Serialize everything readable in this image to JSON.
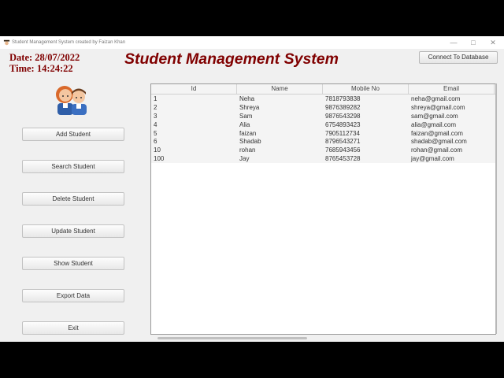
{
  "window": {
    "title": "Student Management System created by Faizan Khan",
    "minimize_glyph": "—",
    "maximize_glyph": "□",
    "close_glyph": "✕"
  },
  "header": {
    "date_label": "Date: 28/07/2022",
    "time_label": "Time: 14:24:22",
    "title": "Student Management System",
    "connect_button": "Connect To Database"
  },
  "sidebar": {
    "buttons": [
      "Add Student",
      "Search Student",
      "Delete Student",
      "Update Student",
      "Show Student",
      "Export Data",
      "Exit"
    ]
  },
  "table": {
    "columns": [
      "Id",
      "Name",
      "Mobile No",
      "Email"
    ],
    "rows": [
      [
        "1",
        "Neha",
        "7818793838",
        "neha@gmail.com"
      ],
      [
        "2",
        "Shreya",
        "9876389282",
        "shreya@gmail.com"
      ],
      [
        "3",
        "Sam",
        "9876543298",
        "sam@gmail.com"
      ],
      [
        "4",
        "Alia",
        "6754893423",
        "alia@gmail.com"
      ],
      [
        "5",
        "faizan",
        "7905112734",
        "faizan@gmail.com"
      ],
      [
        "6",
        "Shadab",
        "8796543271",
        "shadab@gmail.com"
      ],
      [
        "10",
        "rohan",
        "7685943456",
        "rohan@gmail.com"
      ],
      [
        "100",
        "Jay",
        "8765453728",
        "jay@gmail.com"
      ]
    ]
  },
  "icons": {
    "app": "student-cap-icon",
    "avatar": "students-avatar-icon"
  }
}
